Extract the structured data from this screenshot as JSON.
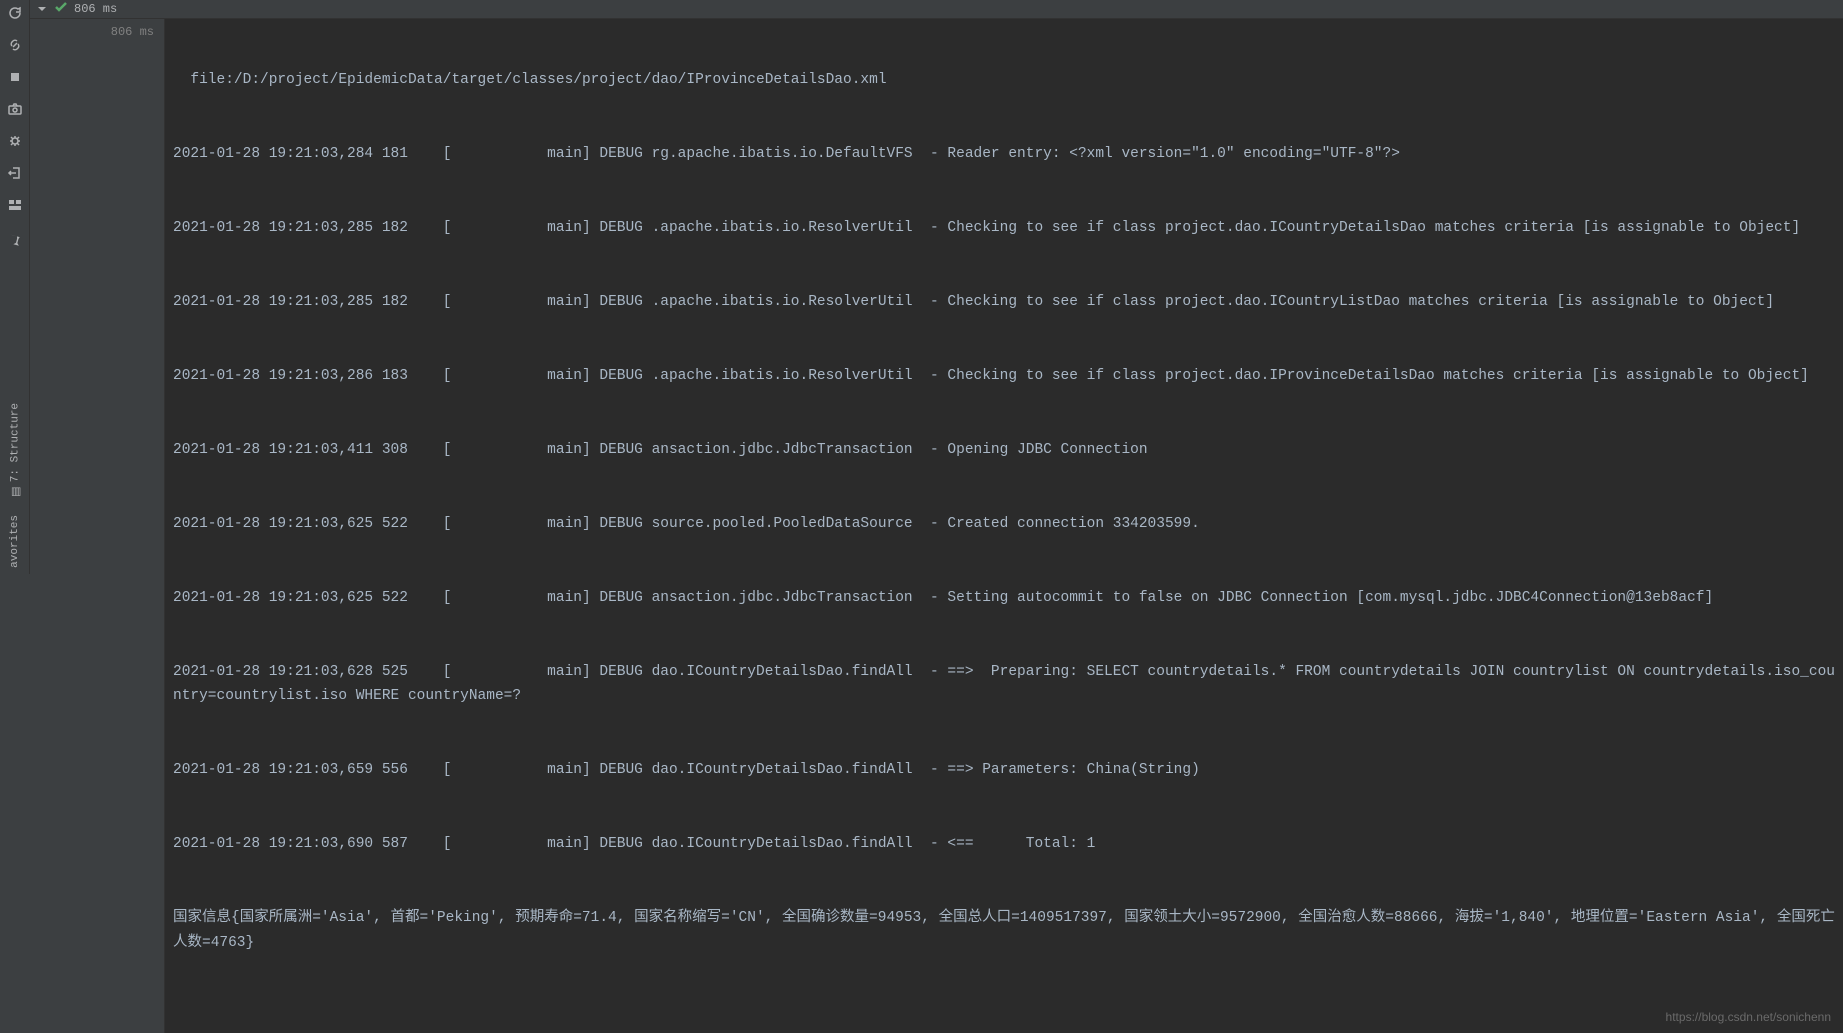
{
  "leftRail": {
    "icons": [
      "refresh",
      "link",
      "stop",
      "camera",
      "bug",
      "exit",
      "layout",
      "pin"
    ]
  },
  "verticalTabs": {
    "structure": "7: Structure",
    "favorites": "avorites"
  },
  "testBar": {
    "duration": "806 ms",
    "treeDuration": "806 ms"
  },
  "console": {
    "lines": [
      "  file:/D:/project/EpidemicData/target/classes/project/dao/IProvinceDetailsDao.xml",
      "2021-01-28 19:21:03,284 181    [           main] DEBUG rg.apache.ibatis.io.DefaultVFS  - Reader entry: <?xml version=\"1.0\" encoding=\"UTF-8\"?>",
      "2021-01-28 19:21:03,285 182    [           main] DEBUG .apache.ibatis.io.ResolverUtil  - Checking to see if class project.dao.ICountryDetailsDao matches criteria [is assignable to Object]",
      "2021-01-28 19:21:03,285 182    [           main] DEBUG .apache.ibatis.io.ResolverUtil  - Checking to see if class project.dao.ICountryListDao matches criteria [is assignable to Object]",
      "2021-01-28 19:21:03,286 183    [           main] DEBUG .apache.ibatis.io.ResolverUtil  - Checking to see if class project.dao.IProvinceDetailsDao matches criteria [is assignable to Object]",
      "2021-01-28 19:21:03,411 308    [           main] DEBUG ansaction.jdbc.JdbcTransaction  - Opening JDBC Connection",
      "2021-01-28 19:21:03,625 522    [           main] DEBUG source.pooled.PooledDataSource  - Created connection 334203599.",
      "2021-01-28 19:21:03,625 522    [           main] DEBUG ansaction.jdbc.JdbcTransaction  - Setting autocommit to false on JDBC Connection [com.mysql.jdbc.JDBC4Connection@13eb8acf]",
      "2021-01-28 19:21:03,628 525    [           main] DEBUG dao.ICountryDetailsDao.findAll  - ==>  Preparing: SELECT countrydetails.* FROM countrydetails JOIN countrylist ON countrydetails.iso_country=countrylist.iso WHERE countryName=?",
      "2021-01-28 19:21:03,659 556    [           main] DEBUG dao.ICountryDetailsDao.findAll  - ==> Parameters: China(String)",
      "2021-01-28 19:21:03,690 587    [           main] DEBUG dao.ICountryDetailsDao.findAll  - <==      Total: 1",
      "国家信息{国家所属洲='Asia', 首都='Peking', 预期寿命=71.4, 国家名称缩写='CN', 全国确诊数量=94953, 全国总人口=1409517397, 国家领土大小=9572900, 全国治愈人数=88666, 海拔='1,840', 地理位置='Eastern Asia', 全国死亡人数=4763}"
    ]
  },
  "watermark": "https://blog.csdn.net/sonichenn"
}
